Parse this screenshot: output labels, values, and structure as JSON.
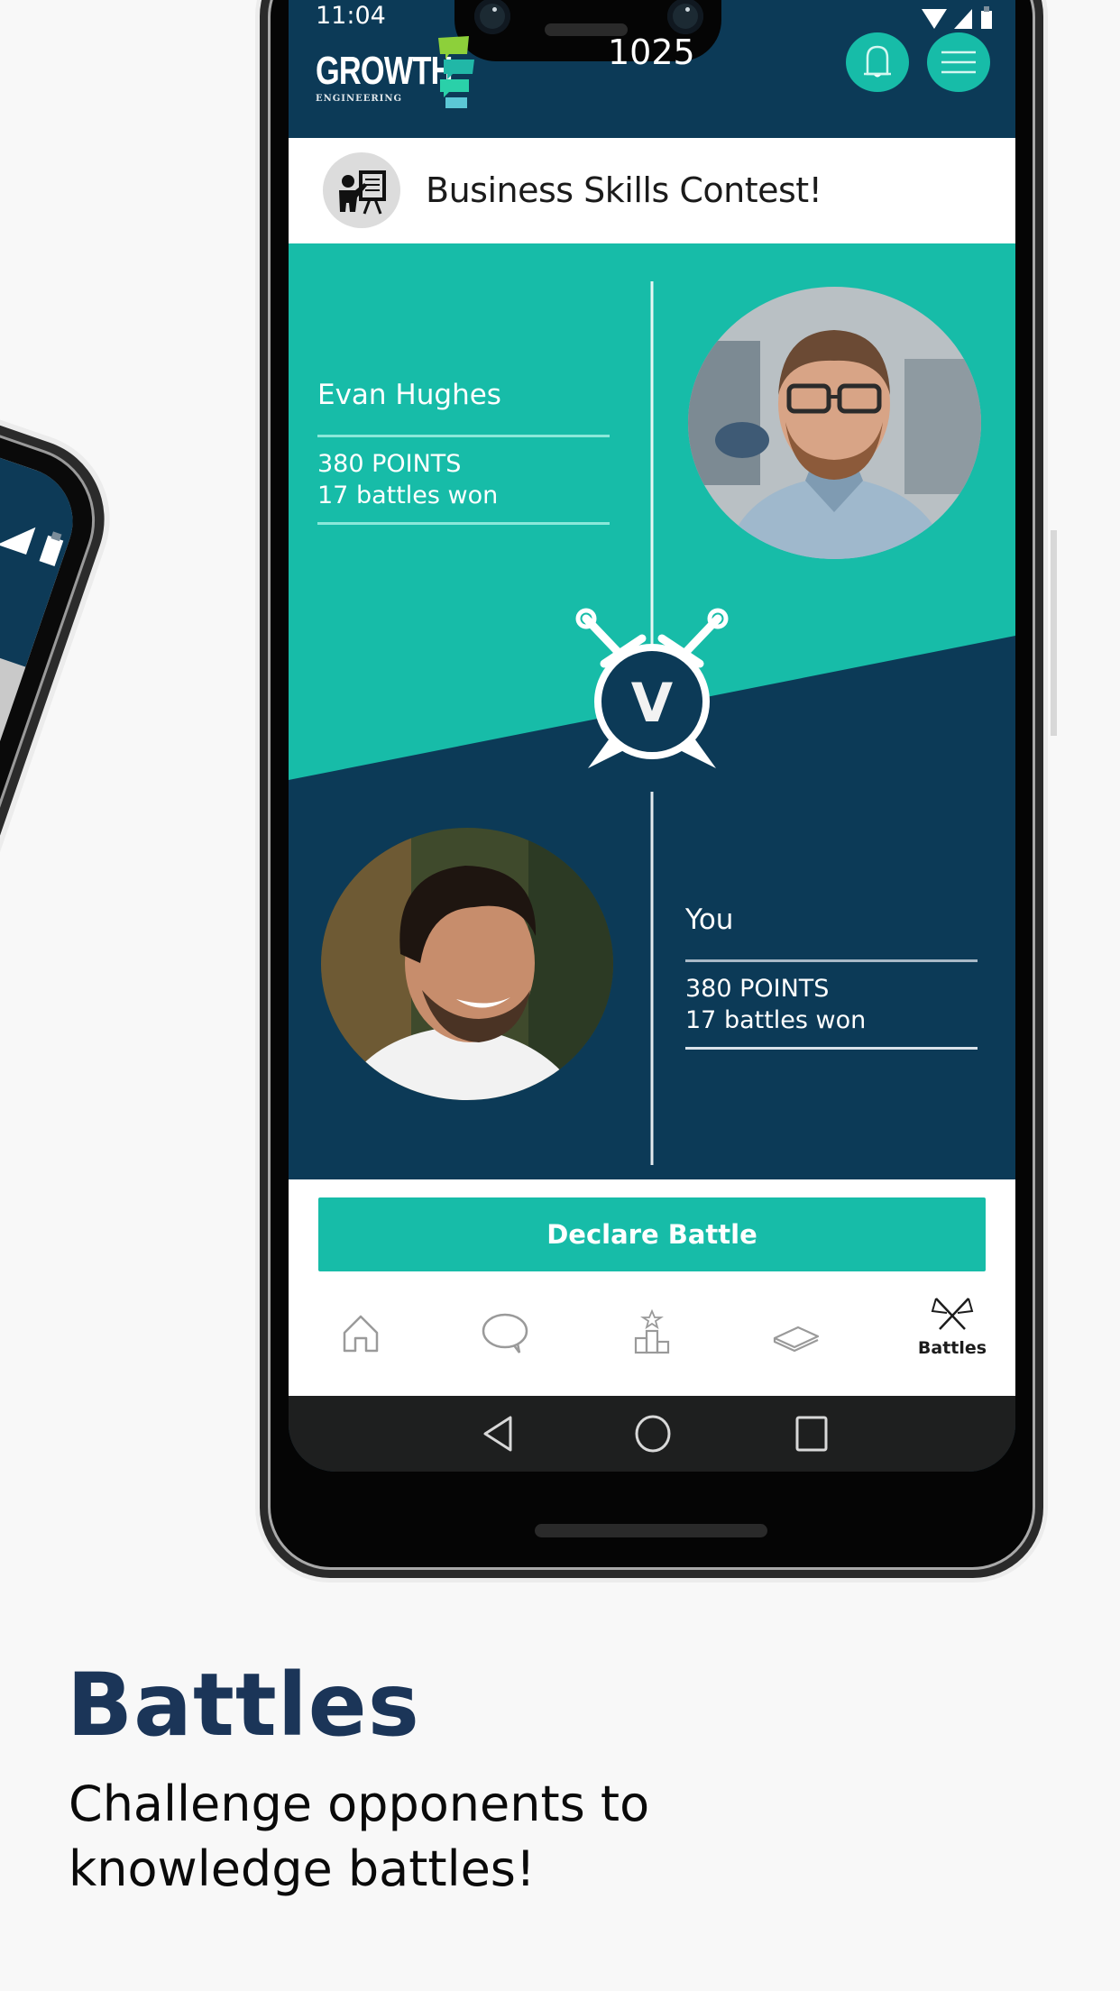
{
  "status_bar": {
    "time": "11:04",
    "icons": [
      "wifi-icon",
      "cellular-signal-icon",
      "battery-icon"
    ]
  },
  "header": {
    "logo_primary": "GROWTH",
    "logo_secondary": "ENGINEERING",
    "score": "1025",
    "notification_icon": "bell-icon",
    "menu_icon": "hamburger-menu-icon"
  },
  "contest": {
    "icon": "presentation-board-icon",
    "title": "Business Skills Contest!"
  },
  "opponent": {
    "name": "Evan Hughes",
    "points": "380 POINTS",
    "battles_won": "17 battles won",
    "avatar": "opponent-photo"
  },
  "versus": {
    "letter": "V",
    "icon": "crossed-swords-shield-icon"
  },
  "player": {
    "name": "You",
    "points": "380 POINTS",
    "battles_won": "17 battles won",
    "avatar": "player-photo"
  },
  "actions": {
    "declare_battle": "Declare Battle"
  },
  "bottom_nav": {
    "items": [
      {
        "icon": "home-icon",
        "label": ""
      },
      {
        "icon": "chat-bubble-icon",
        "label": ""
      },
      {
        "icon": "leaderboard-podium-icon",
        "label": ""
      },
      {
        "icon": "book-icon",
        "label": ""
      },
      {
        "icon": "crossed-flags-icon",
        "label": "Battles",
        "active": true
      }
    ]
  },
  "system_nav": [
    "back-icon",
    "home-circle-icon",
    "recents-icon"
  ],
  "caption": {
    "title": "Battles",
    "subtitle_line1": "Challenge opponents to",
    "subtitle_line2": "knowledge battles!"
  },
  "colors": {
    "teal": "#17bca8",
    "navy": "#0c3a57",
    "caption_title": "#1b3558"
  }
}
